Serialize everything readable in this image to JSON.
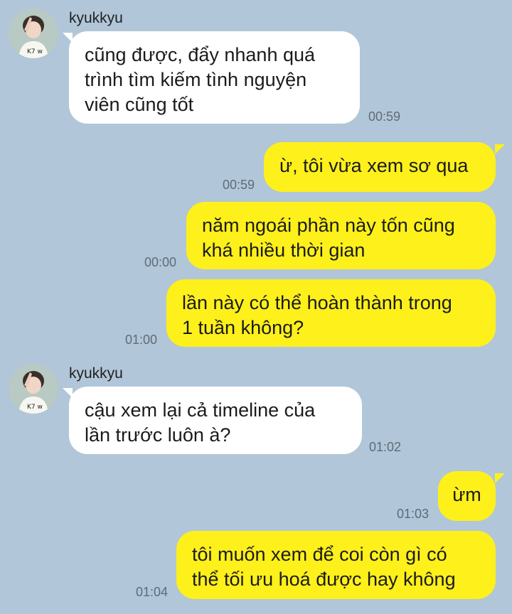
{
  "colors": {
    "background": "#b1c6d9",
    "incoming_bubble": "#ffffff",
    "outgoing_bubble": "#fef01b",
    "timestamp": "#5f6b77"
  },
  "messages": [
    {
      "direction": "incoming",
      "sender": "kyukkyu",
      "avatar": "profile-photo",
      "text": "cũng được, đẩy nhanh quá\ntrình tìm kiếm tình nguyện\nviên cũng tốt",
      "time": "00:59"
    },
    {
      "direction": "outgoing",
      "text": "ừ, tôi vừa xem sơ qua",
      "time": "00:59"
    },
    {
      "direction": "outgoing",
      "text": "năm ngoái phần này tốn cũng\nkhá nhiều thời gian",
      "time": "00:00"
    },
    {
      "direction": "outgoing",
      "text": "lần này có thể hoàn thành trong\n1 tuần không?",
      "time": "01:00"
    },
    {
      "direction": "incoming",
      "sender": "kyukkyu",
      "avatar": "profile-photo",
      "text": "cậu xem lại cả timeline của\nlần trước luôn à?",
      "time": "01:02"
    },
    {
      "direction": "outgoing",
      "text": "ừm",
      "time": "01:03"
    },
    {
      "direction": "outgoing",
      "text": "tôi muốn xem để coi còn gì có\nthể tối ưu hoá được hay không",
      "time": "01:04"
    }
  ]
}
